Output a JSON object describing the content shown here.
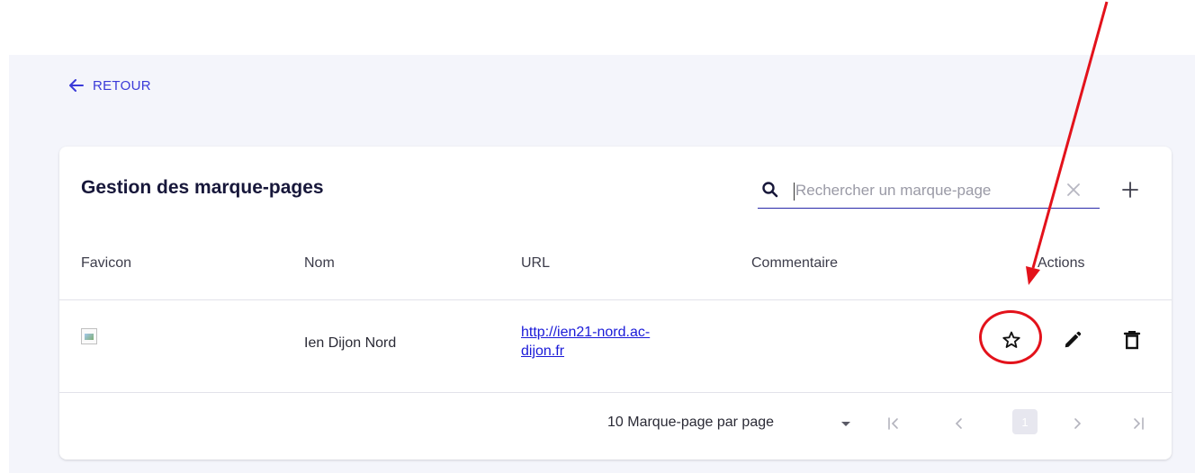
{
  "back": {
    "label": "RETOUR"
  },
  "card": {
    "title": "Gestion des marque-pages",
    "search": {
      "placeholder": "Rechercher un marque-page",
      "value": ""
    }
  },
  "table": {
    "columns": [
      "Favicon",
      "Nom",
      "URL",
      "Commentaire",
      "Actions"
    ],
    "rows": [
      {
        "name": "Ien Dijon Nord",
        "url_line1": "http://ien21-nord.ac-",
        "url_line2": "dijon.fr",
        "comment": ""
      }
    ]
  },
  "pagination": {
    "per_page_label": "10 Marque-page par page",
    "current_page": "1"
  },
  "icons": {
    "back": "arrow-left-icon",
    "search": "search-icon",
    "clear": "close-icon",
    "add": "plus-icon",
    "favorite": "star-outline-icon",
    "edit": "pencil-icon",
    "delete": "trash-icon",
    "dropdown": "caret-down-icon",
    "first": "first-page-icon",
    "prev": "chevron-left-icon",
    "next": "chevron-right-icon",
    "last": "last-page-icon"
  },
  "colors": {
    "accent": "#3a3ad8",
    "annotation": "#e3121b",
    "background": "#f4f5fb",
    "title": "#17173a"
  }
}
